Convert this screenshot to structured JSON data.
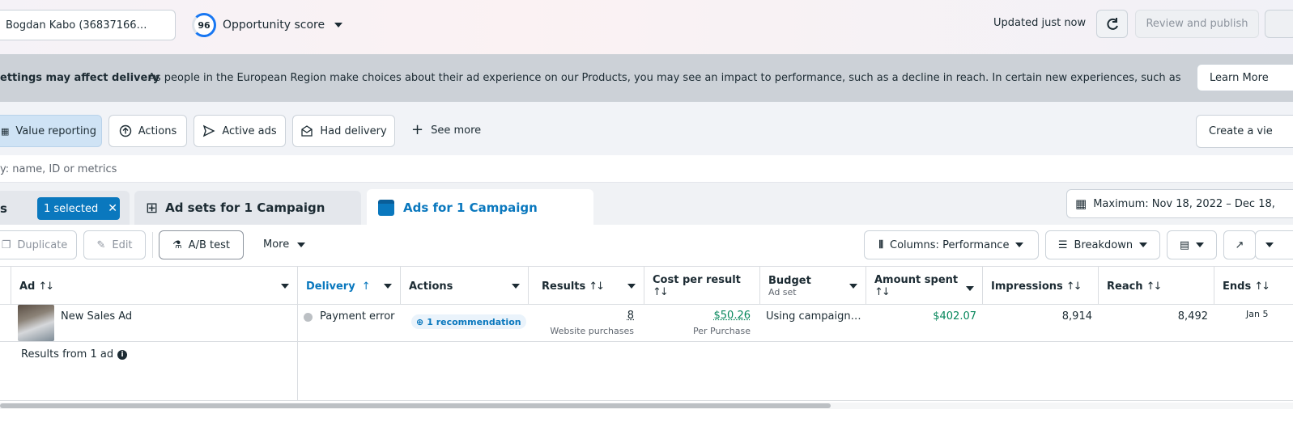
{
  "topbar": {
    "account": "Bogdan Kabo (36837166…",
    "opportunity_score": "96",
    "opportunity_label": "Opportunity score",
    "updated": "Updated just now",
    "review_publish": "Review and publish"
  },
  "banner": {
    "title": "ettings may affect delivery",
    "text": "As people in the European Region make choices about their ad experience on our Products, you may see an impact to performance, such as a decline in reach. In certain new experiences, such as less-pers…",
    "learn_more": "Learn More"
  },
  "filters": {
    "value_reporting": "Value reporting",
    "actions": "Actions",
    "active_ads": "Active ads",
    "had_delivery": "Had delivery",
    "see_more": "See more",
    "create_view": "Create a vie"
  },
  "search": {
    "placeholder": "y: name, ID or metrics"
  },
  "tabs": {
    "left_partial": "s",
    "selected_badge": "1 selected",
    "adsets": "Ad sets for 1 Campaign",
    "ads": "Ads for 1 Campaign",
    "date_range": "Maximum: Nov 18, 2022 – Dec 18,"
  },
  "toolbar": {
    "duplicate": "Duplicate",
    "edit": "Edit",
    "ab_test": "A/B test",
    "more": "More",
    "columns": "Columns: Performance",
    "breakdown": "Breakdown"
  },
  "table": {
    "headers": {
      "ad": "Ad",
      "delivery": "Delivery",
      "actions": "Actions",
      "results": "Results",
      "cost_per_result": "Cost per result",
      "budget": "Budget",
      "budget_sub": "Ad set",
      "amount_spent": "Amount spent",
      "impressions": "Impressions",
      "reach": "Reach",
      "ends": "Ends"
    },
    "row": {
      "ad_name": "New Sales Ad",
      "delivery": "Payment error",
      "recommendation": "1 recommendation",
      "results": "8",
      "results_sub": "Website purchases",
      "cost": "$50.26",
      "cost_sub": "Per Purchase",
      "budget": "Using campaign…",
      "spent": "$402.07",
      "impressions": "8,914",
      "reach": "8,492",
      "ends": "Jan 5"
    },
    "summary": "Results from 1 ad"
  },
  "colors": {
    "accent_blue": "#0a78be",
    "green": "#07875c",
    "banner_bg": "#ccd1d7"
  }
}
